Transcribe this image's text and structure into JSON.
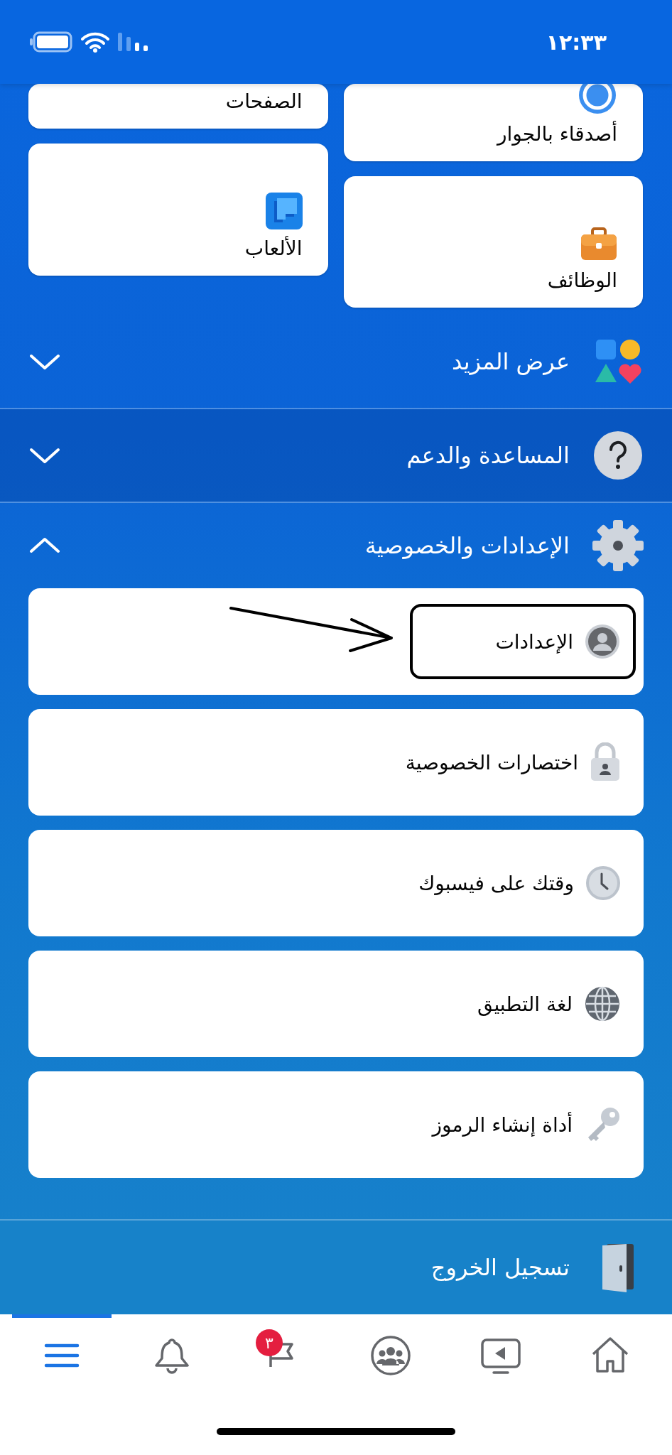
{
  "status_bar": {
    "time": "١٢:٣٣"
  },
  "shortcut_columns": [
    [
      {
        "label": "أصدقاء بالجوار",
        "kind": "nearby"
      },
      {
        "label": "الوظائف",
        "kind": "jobs"
      }
    ],
    [
      {
        "label": "الصفحات"
      },
      {
        "label": "الألعاب",
        "kind": "games"
      }
    ]
  ],
  "sections": [
    {
      "label": "عرض المزيد",
      "kind": "more",
      "expanded": false,
      "pressed": false
    },
    {
      "label": "المساعدة والدعم",
      "kind": "help",
      "expanded": false,
      "pressed": true
    },
    {
      "label": "الإعدادات والخصوصية",
      "kind": "settings",
      "expanded": true,
      "pressed": false,
      "items": [
        {
          "label": "الإعدادات",
          "kind": "account",
          "annotated": true
        },
        {
          "label": "اختصارات الخصوصية",
          "kind": "lock",
          "annotated": false
        },
        {
          "label": "وقتك على فيسبوك",
          "kind": "clock",
          "annotated": false
        },
        {
          "label": "لغة التطبيق",
          "kind": "globe",
          "annotated": false
        },
        {
          "label": "أداة إنشاء الرموز",
          "kind": "key",
          "annotated": false
        }
      ]
    }
  ],
  "logout": {
    "label": "تسجيل الخروج"
  },
  "tab_bar": [
    {
      "kind": "home",
      "selected": false
    },
    {
      "kind": "video",
      "selected": false
    },
    {
      "kind": "groups",
      "selected": false
    },
    {
      "kind": "flag",
      "selected": false,
      "badge": "٣"
    },
    {
      "kind": "bell",
      "selected": false
    },
    {
      "kind": "menu",
      "selected": true
    }
  ]
}
